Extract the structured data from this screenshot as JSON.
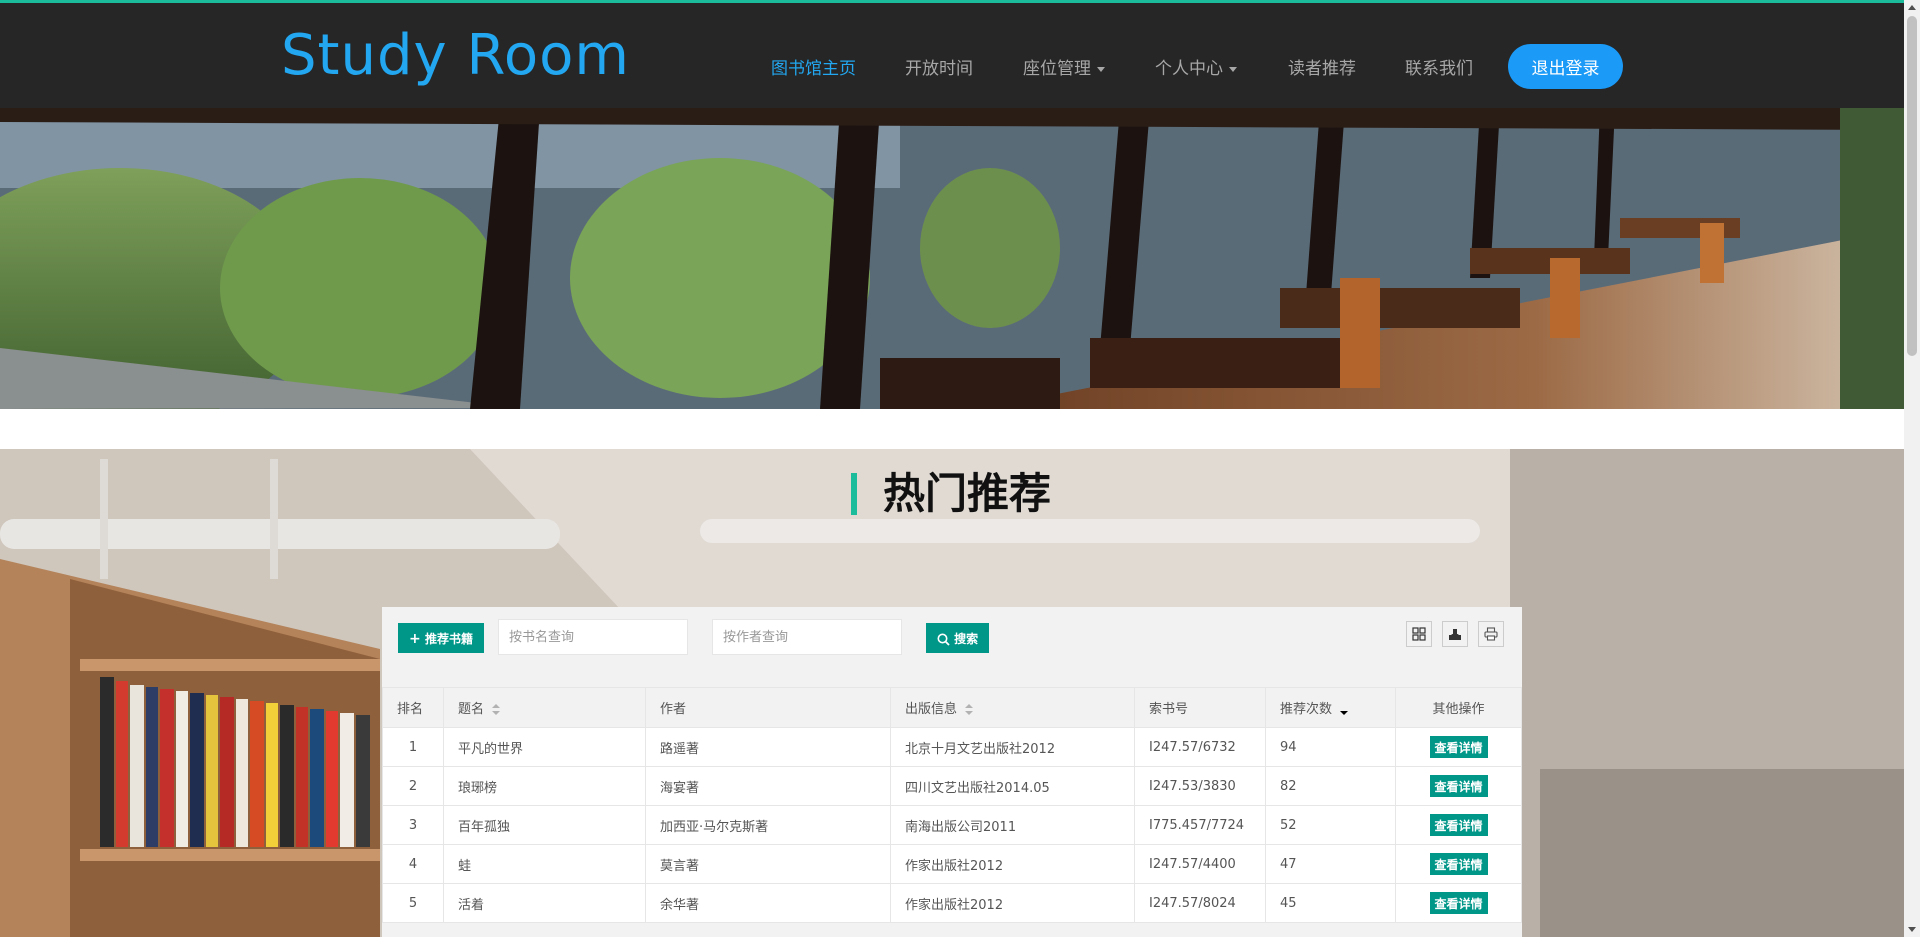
{
  "navbar": {
    "brand": "Study Room",
    "items": [
      {
        "label": "图书馆主页",
        "active": true
      },
      {
        "label": "开放时间"
      },
      {
        "label": "座位管理",
        "dropdown": true
      },
      {
        "label": "个人中心",
        "dropdown": true
      },
      {
        "label": "读者推荐"
      },
      {
        "label": "联系我们"
      }
    ],
    "logout_label": "退出登录"
  },
  "section": {
    "title": "热门推荐"
  },
  "toolbar": {
    "add_label": "推荐书籍",
    "book_placeholder": "按书名查询",
    "author_placeholder": "按作者查询",
    "search_label": "搜索",
    "icons": [
      "columns-icon",
      "export-icon",
      "print-icon"
    ]
  },
  "table": {
    "headers": [
      "排名",
      "题名",
      "作者",
      "出版信息",
      "索书号",
      "推荐次数",
      "其他操作"
    ],
    "rows": [
      {
        "rank": "1",
        "title": "平凡的世界",
        "author": "路遥著",
        "pub": "北京十月文艺出版社2012",
        "call": "I247.57/6732",
        "count": "94",
        "action": "查看详情"
      },
      {
        "rank": "2",
        "title": "琅琊榜",
        "author": "海宴著",
        "pub": "四川文艺出版社2014.05",
        "call": "I247.53/3830",
        "count": "82",
        "action": "查看详情"
      },
      {
        "rank": "3",
        "title": "百年孤独",
        "author": "加西亚·马尔克斯著",
        "pub": "南海出版公司2011",
        "call": "I775.457/7724",
        "count": "52",
        "action": "查看详情"
      },
      {
        "rank": "4",
        "title": "蛙",
        "author": "莫言著",
        "pub": "作家出版社2012",
        "call": "I247.57/4400",
        "count": "47",
        "action": "查看详情"
      },
      {
        "rank": "5",
        "title": "活着",
        "author": "余华著",
        "pub": "作家出版社2012",
        "call": "I247.57/8024",
        "count": "45",
        "action": "查看详情"
      }
    ]
  },
  "colors": {
    "accent": "#1abc9c",
    "brand": "#22a7f0",
    "button": "#1b9af7",
    "table_button": "#009688"
  }
}
